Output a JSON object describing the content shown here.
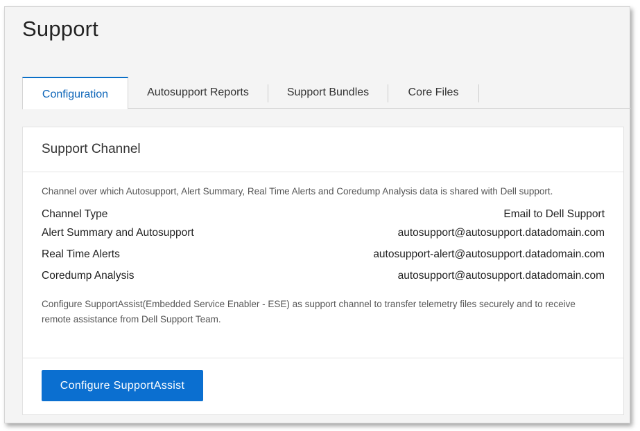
{
  "page": {
    "title": "Support"
  },
  "tabs": [
    {
      "label": "Configuration",
      "active": true
    },
    {
      "label": "Autosupport Reports",
      "active": false
    },
    {
      "label": "Support Bundles",
      "active": false
    },
    {
      "label": "Core Files",
      "active": false
    }
  ],
  "support_channel": {
    "title": "Support Channel",
    "description": "Channel over which Autosupport, Alert Summary, Real Time Alerts and Coredump Analysis data is shared with Dell support.",
    "rows": [
      {
        "label": "Channel Type",
        "value": "Email to Dell Support"
      },
      {
        "label": "Alert Summary and Autosupport",
        "value": "autosupport@autosupport.datadomain.com"
      },
      {
        "label": "Real Time Alerts",
        "value": "autosupport-alert@autosupport.datadomain.com"
      },
      {
        "label": "Coredump Analysis",
        "value": "autosupport@autosupport.datadomain.com"
      }
    ],
    "note": "Configure SupportAssist(Embedded Service Enabler - ESE) as support channel to transfer telemetry files securely and to receive remote assistance from Dell Support Team.",
    "button_label": "Configure SupportAssist"
  },
  "colors": {
    "accent": "#0b6fd0",
    "active_tab_text": "#0b64b8",
    "background": "#f4f4f4"
  }
}
